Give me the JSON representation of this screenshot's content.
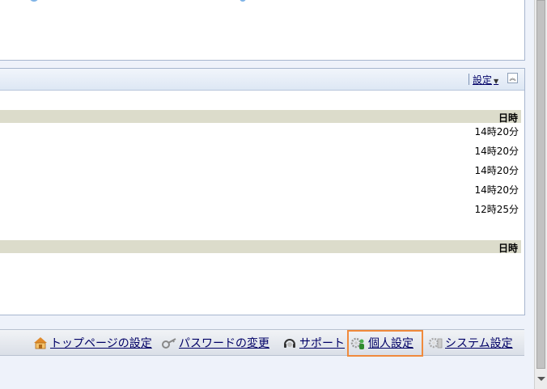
{
  "portlet": {
    "settings_label": "設定",
    "collapse_icon": "collapse-up-icon",
    "table1": {
      "header": "日時",
      "rows": [
        "14時20分",
        "14時20分",
        "14時20分",
        "14時20分",
        "12時25分"
      ]
    },
    "table2": {
      "header": "日時"
    }
  },
  "footer": {
    "links": [
      {
        "label": "トップページの設定",
        "icon": "home-settings-icon"
      },
      {
        "label": "パスワードの変更",
        "icon": "key-icon"
      },
      {
        "label": "サポート",
        "icon": "support-headset-icon"
      },
      {
        "label": "個人設定",
        "icon": "personal-settings-icon"
      },
      {
        "label": "システム設定",
        "icon": "system-settings-icon"
      }
    ],
    "highlight_color": "#f08a3c"
  },
  "colors": {
    "link": "#000066",
    "table_header_bg": "#dcdccb",
    "portlet_header_bg": "#dde7f4"
  }
}
